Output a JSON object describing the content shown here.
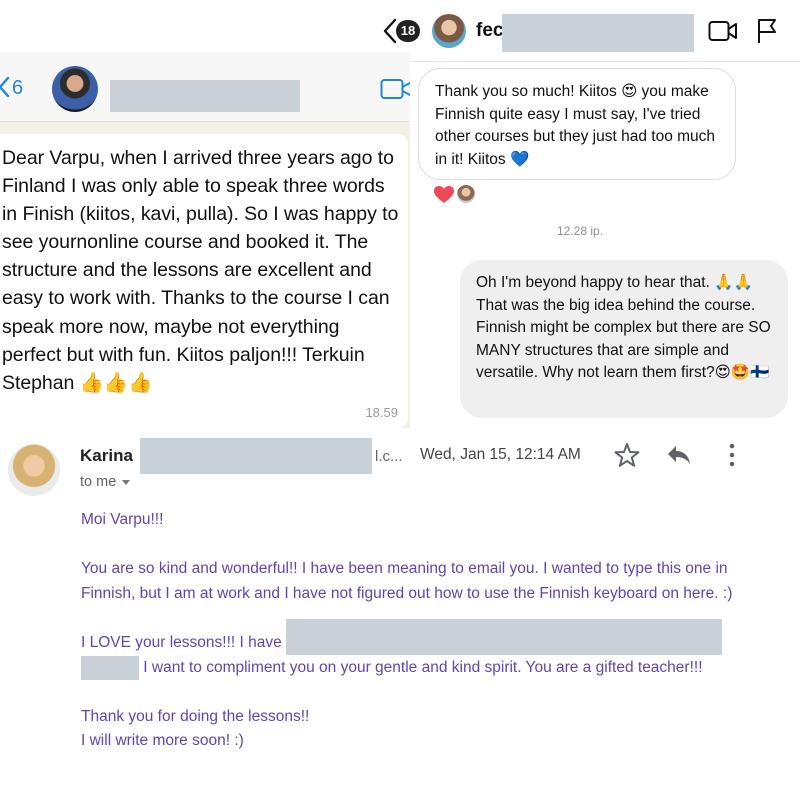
{
  "instagram": {
    "unread_count": "18",
    "contact_name_partial": "fec",
    "messages": [
      {
        "text": "Thank you so much! Kiitos 😍  you make Finnish quite easy I must say, I've tried other courses but they just had too much in it! Kiitos 💙"
      },
      {
        "text": "Oh I'm beyond happy to hear that. 🙏🙏 That was the big idea behind the course. Finnish might be complex but there are SO MANY structures that are simple and versatile. Why not learn them first?😍🤩🇫🇮"
      }
    ],
    "timestamp": "12.28 ip.",
    "reaction_color": "#ed4956"
  },
  "whatsapp": {
    "unread_count": "6",
    "message": "Dear Varpu, when I arrived three years ago to Finland I was only able to speak three words in Finish (kiitos, kavi, pulla). So I was happy to see yournonline course and booked it. The structure and the lessons are excellent and easy to work with. Thanks to the course I can speak more now, maybe not everything perfect but with fun. Kiitos paljon!!! Terkuin Stephan 👍👍👍",
    "time": "18.59",
    "accent_color": "#1f86d8"
  },
  "gmail": {
    "sender_name": "Karina",
    "sender_email_tail": "l.c...",
    "date": "Wed, Jan 15, 12:14 AM",
    "recipient": "to me",
    "body": {
      "greeting": "Moi Varpu!!!",
      "para1": "You are so kind and wonderful!! I have been meaning to email you. I wanted to type this one in Finnish, but I am at work and I have not figured out how to use the Finnish keyboard on here. :)",
      "para2_start": "I LOVE your lessons!!! I have",
      "para2_end": " I want to compliment you on your gentle and kind spirit. You are a gifted teacher!!!",
      "closing1": "Thank you for doing the lessons!!",
      "closing2": "I will write more soon! :)"
    },
    "text_color": "#6244b0"
  },
  "redaction_color": "#c8d0d8"
}
